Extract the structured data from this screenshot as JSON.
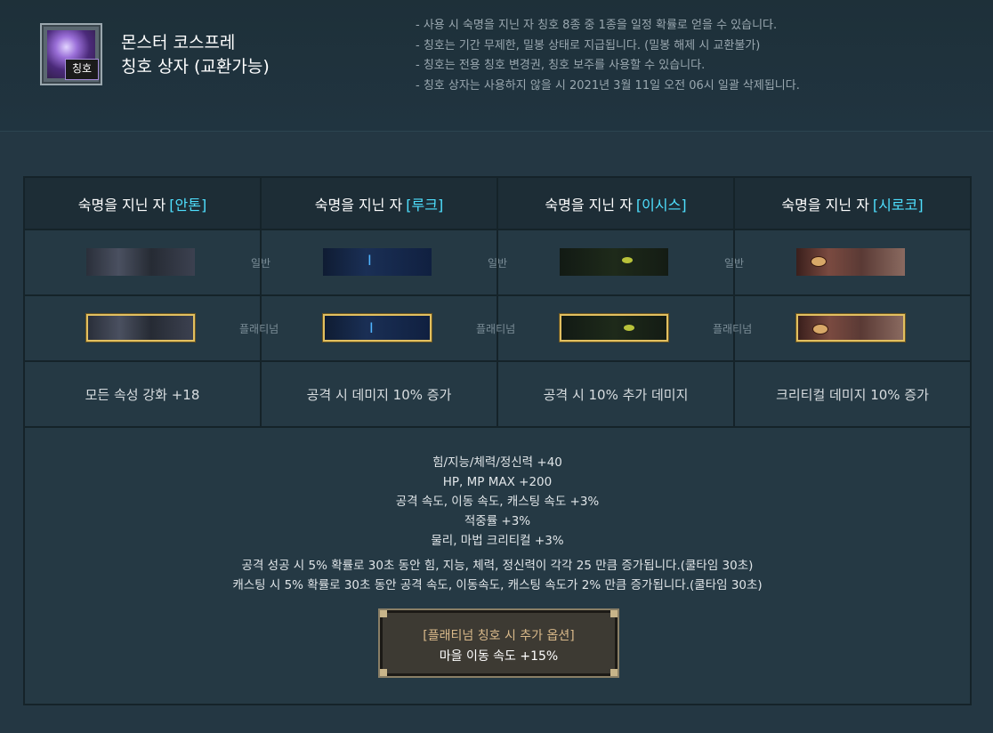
{
  "item": {
    "name_line1": "몬스터 코스프레",
    "name_line2": "칭호 상자 (교환가능)",
    "badge": "칭호"
  },
  "notes": [
    "- 사용 시 숙명을 지닌 자 칭호 8종 중 1종을 일정 확률로 얻을 수 있습니다.",
    "- 칭호는 기간 무제한, 밀봉 상태로 지급됩니다. (밀봉 해제 시 교환불가)",
    "- 칭호는 전용 칭호 변경권, 칭호 보주를 사용할 수 있습니다.",
    "- 칭호 상자는 사용하지 않을 시 2021년 3월 11일 오전 06시 일괄 삭제됩니다."
  ],
  "columns": [
    {
      "prefix": "숙명을 지닌 자",
      "name": "[안톤]",
      "effect": "모든 속성 강화 +18"
    },
    {
      "prefix": "숙명을 지닌 자",
      "name": "[루크]",
      "effect": "공격 시 데미지 10% 증가"
    },
    {
      "prefix": "숙명을 지닌 자",
      "name": "[이시스]",
      "effect": "공격 시 10% 추가 데미지"
    },
    {
      "prefix": "숙명을 지닌 자",
      "name": "[시로코]",
      "effect": "크리티컬 데미지 10% 증가"
    }
  ],
  "grades": {
    "normal": "일반",
    "platinum": "플래티넘"
  },
  "common_stats": [
    "힘/지능/체력/정신력 +40",
    "HP, MP MAX +200",
    "공격 속도, 이동 속도, 캐스팅 속도 +3%",
    "적중률 +3%",
    "물리, 마법 크리티컬 +3%"
  ],
  "proc_stats": [
    "공격 성공 시 5% 확률로 30초 동안 힘, 지능, 체력, 정신력이 각각 25 만큼 증가됩니다.(쿨타임 30초)",
    "캐스팅 시 5% 확률로 30초 동안 공격 속도, 이동속도, 캐스팅 속도가 2% 만큼 증가됩니다.(쿨타임 30초)"
  ],
  "platinum_bonus": {
    "title": "[플래티넘 칭호 시 추가 옵션]",
    "value": "마을 이동 속도 +15%"
  },
  "colors": {
    "highlight": "#4fe0ff",
    "platinum_frame": "#e2c060",
    "background": "#243743"
  }
}
